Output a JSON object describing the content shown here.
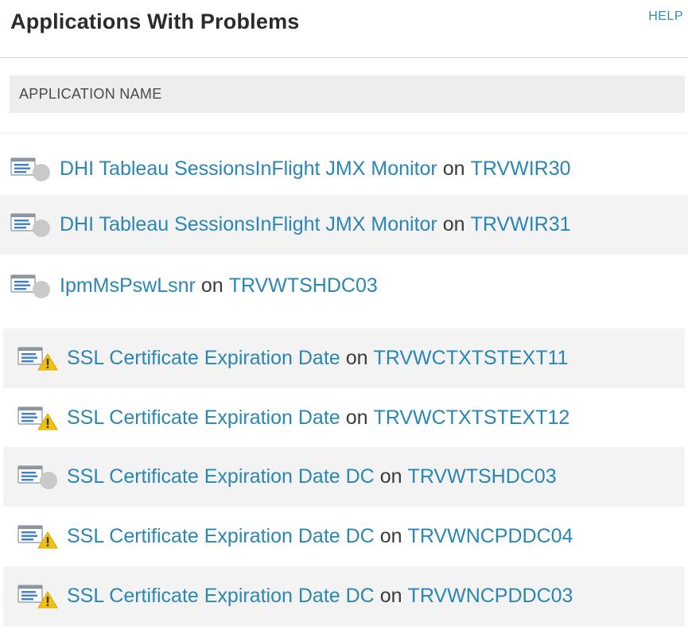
{
  "header": {
    "title": "Applications With Problems",
    "help_label": "HELP"
  },
  "table": {
    "column_header": "APPLICATION NAME"
  },
  "rows": [
    {
      "app": "DHI Tableau SessionsInFlight JMX Monitor",
      "connector": "on",
      "node": "TRVWIR30",
      "status_icon": "app-unknown-icon"
    },
    {
      "app": "DHI Tableau SessionsInFlight JMX Monitor",
      "connector": "on",
      "node": "TRVWIR31",
      "status_icon": "app-unknown-icon"
    },
    {
      "app": "IpmMsPswLsnr",
      "connector": "on",
      "node": "TRVWTSHDC03",
      "status_icon": "app-unknown-icon"
    },
    {
      "app": "SSL Certificate Expiration Date",
      "connector": "on",
      "node": "TRVWCTXTSTEXT11",
      "status_icon": "app-warning-icon"
    },
    {
      "app": "SSL Certificate Expiration Date",
      "connector": "on",
      "node": "TRVWCTXTSTEXT12",
      "status_icon": "app-warning-icon"
    },
    {
      "app": "SSL Certificate Expiration Date DC",
      "connector": "on",
      "node": "TRVWTSHDC03",
      "status_icon": "app-unknown-icon"
    },
    {
      "app": "SSL Certificate Expiration Date DC",
      "connector": "on",
      "node": "TRVWNCPDDC04",
      "status_icon": "app-warning-icon"
    },
    {
      "app": "SSL Certificate Expiration Date DC",
      "connector": "on",
      "node": "TRVWNCPDDC03",
      "status_icon": "app-warning-icon"
    }
  ],
  "colors": {
    "link": "#2a86b2",
    "warning": "#f2c011",
    "unknown": "#c9c9c9"
  }
}
